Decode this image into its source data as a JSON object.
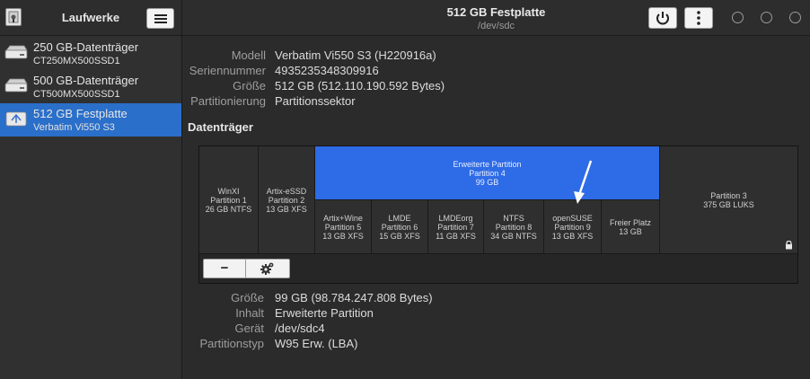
{
  "sidebar": {
    "title": "Laufwerke",
    "drives": [
      {
        "name": "250 GB-Datenträger",
        "model": "CT250MX500SSD1"
      },
      {
        "name": "500 GB-Datenträger",
        "model": "CT500MX500SSD1"
      },
      {
        "name": "512 GB Festplatte",
        "model": "Verbatim Vi550 S3"
      }
    ],
    "selected_index": 2
  },
  "header": {
    "title": "512 GB Festplatte",
    "subtitle": "/dev/sdc",
    "icons": [
      "power-icon",
      "kebab-menu-icon"
    ]
  },
  "disk_info": {
    "rows": [
      {
        "label": "Modell",
        "value": "Verbatim Vi550 S3 (H220916a)"
      },
      {
        "label": "Seriennummer",
        "value": "4935235348309916"
      },
      {
        "label": "Größe",
        "value": "512 GB (512.110.190.592 Bytes)"
      },
      {
        "label": "Partitionierung",
        "value": "Partitionssektor"
      }
    ]
  },
  "volumes": {
    "heading": "Datenträger",
    "partitions": {
      "winxi": {
        "l1": "WinXI",
        "l2": "Partition 1",
        "l3": "26 GB NTFS"
      },
      "artix_essd": {
        "l1": "Artix-eSSD",
        "l2": "Partition 2",
        "l3": "13 GB XFS"
      },
      "extended": {
        "l1": "Erweiterte Partition",
        "l2": "Partition 4",
        "l3": "99 GB"
      },
      "artix_wine": {
        "l1": "Artix+Wine",
        "l2": "Partition 5",
        "l3": "13 GB XFS"
      },
      "lmde": {
        "l1": "LMDE",
        "l2": "Partition 6",
        "l3": "15 GB XFS"
      },
      "lmdeorg": {
        "l1": "LMDEorg",
        "l2": "Partition 7",
        "l3": "11 GB XFS"
      },
      "ntfs": {
        "l1": "NTFS",
        "l2": "Partition 8",
        "l3": "34 GB NTFS"
      },
      "opensuse": {
        "l1": "openSUSE",
        "l2": "Partition 9",
        "l3": "13 GB XFS"
      },
      "free": {
        "l1": "Freier Platz",
        "l2": "13 GB"
      },
      "luks": {
        "l1": "Partition 3",
        "l2": "375 GB LUKS"
      }
    },
    "toolbar": {
      "remove_label": "−"
    }
  },
  "partition_info": {
    "rows": [
      {
        "label": "Größe",
        "value": "99 GB (98.784.247.808 Bytes)"
      },
      {
        "label": "Inhalt",
        "value": "Erweiterte Partition"
      },
      {
        "label": "Gerät",
        "value": "/dev/sdc4"
      },
      {
        "label": "Partitionstyp",
        "value": "W95 Erw. (LBA)"
      }
    ]
  },
  "colors": {
    "selected": "#2a6fc9",
    "partition_selected": "#2e6be6",
    "background": "#2b2b2b"
  }
}
